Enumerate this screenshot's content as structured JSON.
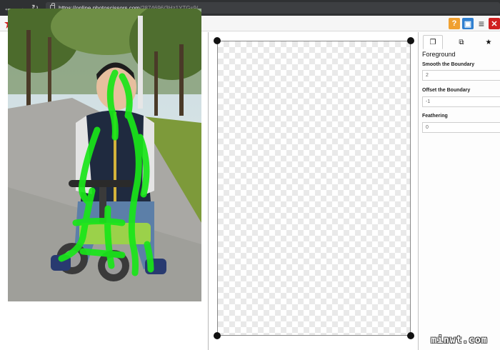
{
  "browser": {
    "url_host": "https://online.photoscissors.com",
    "url_path": "/2874696/3Hz1YTGs9/"
  },
  "toolbar": {
    "buttons": [
      {
        "name": "undo-icon",
        "glyph": "↶"
      },
      {
        "name": "redo-icon",
        "glyph": "↷"
      },
      {
        "name": "foreground-marker-icon",
        "glyph": "+"
      },
      {
        "name": "background-marker-icon",
        "glyph": "−"
      },
      {
        "name": "eraser-icon",
        "glyph": "⌫"
      },
      {
        "name": "move-icon",
        "glyph": "✥"
      },
      {
        "name": "zoom-in-icon",
        "glyph": "⊕"
      },
      {
        "name": "zoom-out-icon",
        "glyph": "⊖"
      },
      {
        "name": "zoom-fit-icon",
        "glyph": "⊙"
      },
      {
        "name": "zoom-actual-icon",
        "glyph": "⊚"
      }
    ],
    "active_tool": "foreground-marker-icon",
    "brush_size_level": 0.15,
    "right_buttons": [
      {
        "name": "help-icon",
        "glyph": "?",
        "color": "#f0a030"
      },
      {
        "name": "save-icon",
        "glyph": "▣",
        "color": "#2f7fd0"
      },
      {
        "name": "menu-icon",
        "glyph": "≡",
        "color": "#333333"
      },
      {
        "name": "close-icon",
        "glyph": "✕",
        "color": "#d02020"
      }
    ]
  },
  "panel": {
    "tabs": [
      {
        "name": "tab-foreground",
        "glyph": "❐"
      },
      {
        "name": "tab-background",
        "glyph": "⧉"
      },
      {
        "name": "tab-favorites",
        "glyph": "★"
      }
    ],
    "title": "Foreground",
    "fields": [
      {
        "label": "Smooth the Boundary",
        "value": "2"
      },
      {
        "label": "Offset the Boundary",
        "value": "-1"
      },
      {
        "label": "Feathering",
        "value": "0"
      }
    ]
  },
  "colors": {
    "marker_green": "#19e619",
    "toolbar_bg": "#f6f6f6",
    "chrome_bg": "#2f3133"
  },
  "watermark": "minwt.com"
}
